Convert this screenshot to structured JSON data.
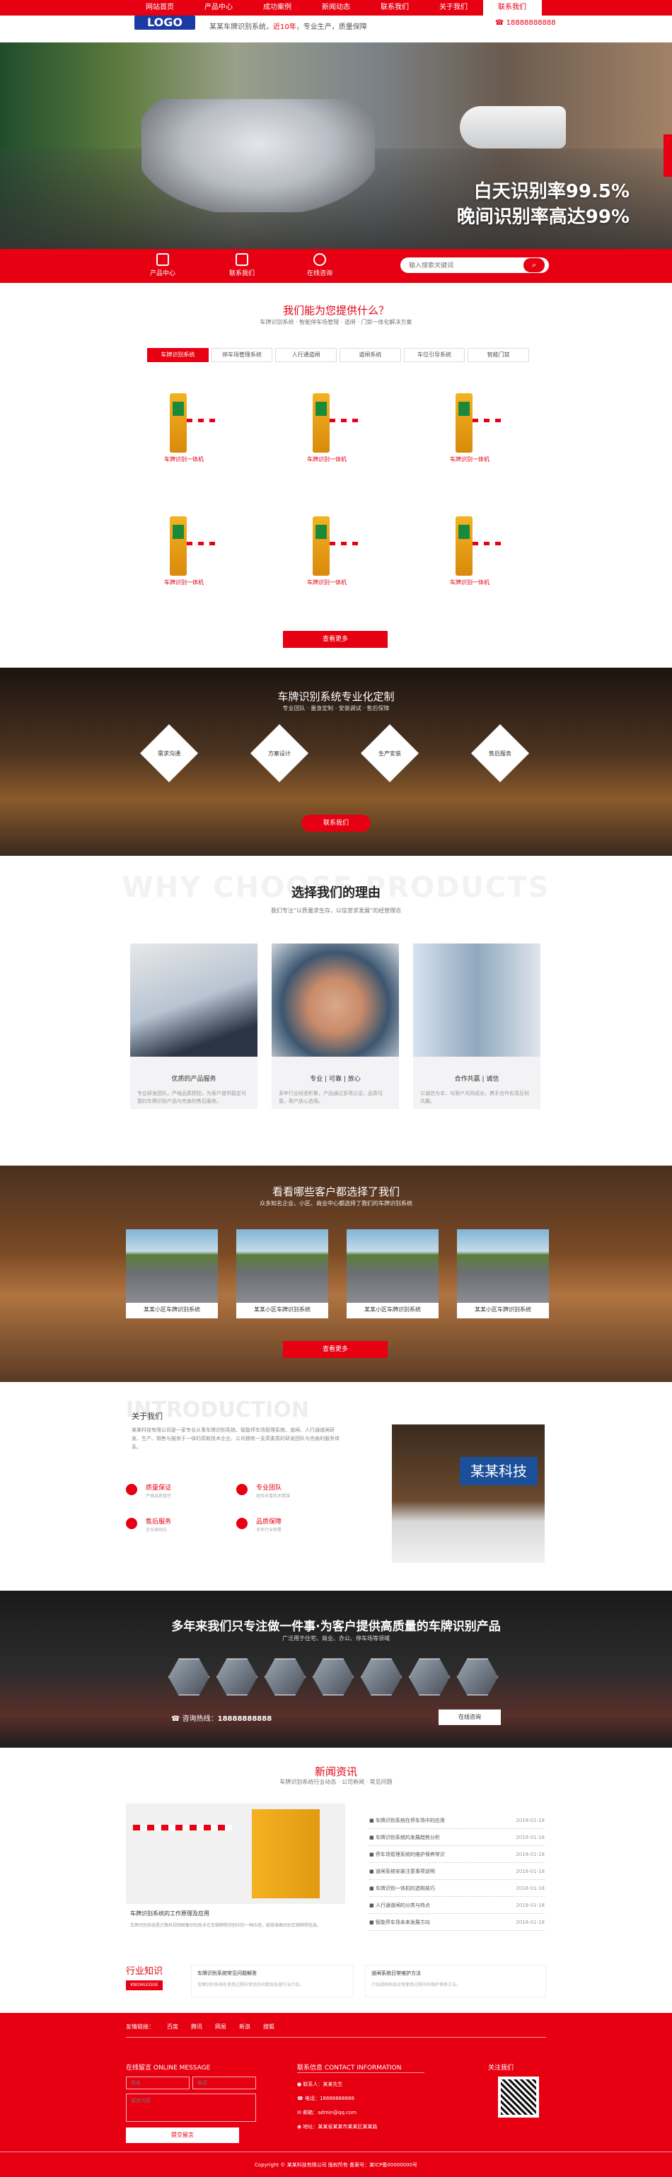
{
  "nav": {
    "items": [
      "网站首页",
      "产品中心",
      "成功案例",
      "新闻动态",
      "联系我们",
      "关于我们",
      "联系我们"
    ]
  },
  "header": {
    "logo": "LOGO",
    "slogan_pre": "某某车牌识别系统，",
    "slogan_hl": "近10年",
    "slogan_post": "，专业生产，质量保障",
    "hotline": "18888888888"
  },
  "banner": {
    "line1": "白天识别率99.5%",
    "line2": "晚间识别率高达99%"
  },
  "quick": {
    "items": [
      "产品中心",
      "联系我们",
      "在线咨询"
    ],
    "search_placeholder": "输入搜索关键词",
    "search_icon": "search-icon"
  },
  "products": {
    "title": "我们能为您提供什么？",
    "subtitle": "车牌识别系统 · 智能停车场管理 · 道闸 · 门禁一体化解决方案",
    "tabs": [
      "车牌识别系统",
      "停车场管理系统",
      "人行通道闸",
      "道闸系统",
      "车位引导系统",
      "智能门禁"
    ],
    "items": [
      "车牌识别一体机",
      "车牌识别一体机",
      "车牌识别一体机",
      "车牌识别一体机",
      "车牌识别一体机",
      "车牌识别一体机"
    ],
    "more": "查看更多"
  },
  "custom": {
    "title": "车牌识别系统专业化定制",
    "subtitle": "专业团队 · 量身定制 · 安装调试 · 售后保障",
    "items": [
      "需求沟通",
      "方案设计",
      "生产安装",
      "售后服务"
    ],
    "button": "联系我们"
  },
  "why": {
    "ghost": "WHY CHOOSE PRODUCTS",
    "title": "选择我们的理由",
    "subtitle": "我们专注“以质量求生存，以信誉求发展”的经营理念",
    "cards": [
      {
        "title": "优质的产品服务",
        "desc": "专业研发团队，严格品质把控，为客户提供稳定可靠的车牌识别产品与完善的售后服务。"
      },
      {
        "title": "专业 | 可靠 | 放心",
        "desc": "多年行业经验积累，产品通过多项认证，品质可靠，客户放心选用。"
      },
      {
        "title": "合作共赢 | 诚信",
        "desc": "以诚信为本，与客户共同成长，携手合作实现互利共赢。"
      }
    ]
  },
  "clients": {
    "title": "看看哪些客户都选择了我们",
    "subtitle": "众多知名企业、小区、商业中心都选择了我们的车牌识别系统",
    "items": [
      "某某小区车牌识别系统",
      "某某小区车牌识别系统",
      "某某小区车牌识别系统",
      "某某小区车牌识别系统"
    ],
    "more": "查看更多"
  },
  "about": {
    "ghost": "INTRODUCTION",
    "title": "关于我们",
    "desc": "某某科技有限公司是一家专业从事车牌识别系统、智能停车场管理系统、道闸、人行通道闸研发、生产、销售与服务于一体的高新技术企业，公司拥有一支高素质的研发团队与完善的服务体系。",
    "features": [
      {
        "t": "质量保证",
        "d": "严格品质管控"
      },
      {
        "t": "专业团队",
        "d": "经验丰富技术精湛"
      },
      {
        "t": "售后服务",
        "d": "全天候响应"
      },
      {
        "t": "品质保障",
        "d": "多年行业积累"
      }
    ],
    "photo_text": "某某科技"
  },
  "strip": {
    "title": "多年来我们只专注做一件事·为客户提供高质量的车牌识别产品",
    "subtitle": "广泛用于住宅、商业、办公、停车场等领域",
    "hotline_label": "咨询热线：",
    "hotline": "18888888888",
    "button": "在线咨询"
  },
  "news": {
    "title": "新闻资讯",
    "subtitle": "车牌识别系统行业动态 · 公司新闻 · 常见问题",
    "feature_title": "车牌识别系统的工作原理及应用",
    "feature_desc": "车牌识别系统是计算机视频图像识别技术在车辆牌照识别中的一种应用，能够准确识别车辆牌照信息。",
    "rows": [
      {
        "t": "车牌识别系统在停车场中的应用",
        "d": "2018-01-18"
      },
      {
        "t": "车牌识别系统的发展趋势分析",
        "d": "2018-01-18"
      },
      {
        "t": "停车场管理系统的维护保养常识",
        "d": "2018-01-18"
      },
      {
        "t": "道闸系统安装注意事项说明",
        "d": "2018-01-18"
      },
      {
        "t": "车牌识别一体机的选购技巧",
        "d": "2018-01-18"
      },
      {
        "t": "人行通道闸的分类与特点",
        "d": "2018-01-18"
      },
      {
        "t": "智能停车场未来发展方向",
        "d": "2018-01-18"
      }
    ],
    "knowledge_title": "行业知识",
    "knowledge_en": "KNOWLEDGE",
    "knowledge": [
      {
        "t": "车牌识别系统常见问题解答",
        "d": "车牌识别系统在使用过程中常见的问题及处理方法介绍。"
      },
      {
        "t": "道闸系统日常维护方法",
        "d": "介绍道闸系统日常使用过程中的维护保养方法。"
      }
    ]
  },
  "footer": {
    "links": [
      "友情链接：",
      "百度",
      "腾讯",
      "网易",
      "新浪",
      "搜狐"
    ],
    "online_title": "在线留言 ONLINE MESSAGE",
    "name_ph": "姓名",
    "phone_ph": "电话",
    "msg_ph": "留言内容",
    "submit": "提交留言",
    "contact_title": "联系信息 CONTACT INFORMATION",
    "contacts": [
      "联系人：某某先生",
      "电话：18888888888",
      "邮箱：admin@qq.com",
      "地址：某某省某某市某某区某某路"
    ],
    "follow": "关注我们",
    "copyright": "Copyright © 某某科技有限公司 版权所有  备案号：某ICP备00000000号"
  }
}
